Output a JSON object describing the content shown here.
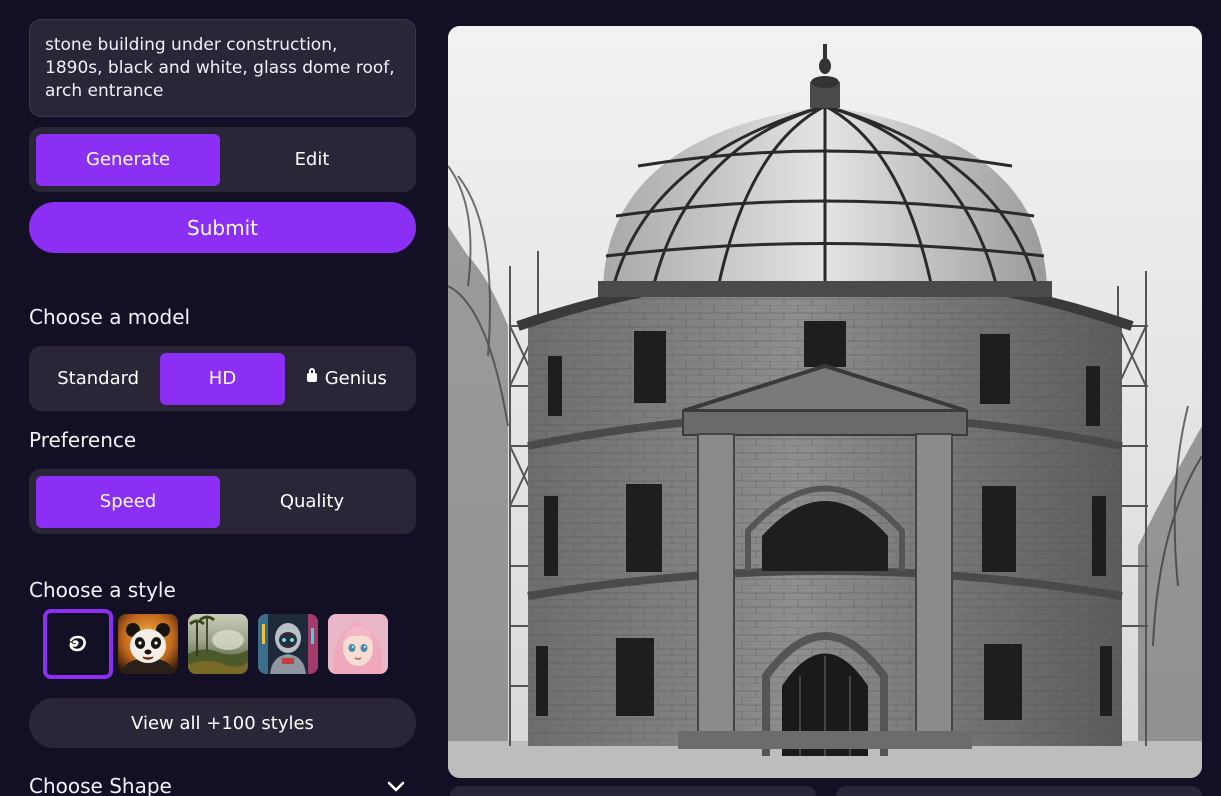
{
  "prompt": {
    "text": "stone building under construction, 1890s, black and white, glass dome roof, arch entrance"
  },
  "mode_tabs": [
    {
      "label": "Generate",
      "active": true
    },
    {
      "label": "Edit",
      "active": false
    }
  ],
  "submit_label": "Submit",
  "model": {
    "heading": "Choose a model",
    "options": [
      {
        "label": "Standard",
        "active": false,
        "locked": false
      },
      {
        "label": "HD",
        "active": true,
        "locked": false
      },
      {
        "label": "Genius",
        "active": false,
        "locked": true
      }
    ]
  },
  "preference": {
    "heading": "Preference",
    "options": [
      {
        "label": "Speed",
        "active": true
      },
      {
        "label": "Quality",
        "active": false
      }
    ]
  },
  "style": {
    "heading": "Choose a style",
    "thumbnails": [
      "no-style-icon",
      "panda-style",
      "jungle-landscape-style",
      "robot-style",
      "anime-girl-style"
    ],
    "view_all_label": "View all +100 styles"
  },
  "shape": {
    "heading": "Choose Shape"
  },
  "colors": {
    "accent": "#8b2ff5",
    "background": "#130f25",
    "panel": "#2a2638"
  }
}
